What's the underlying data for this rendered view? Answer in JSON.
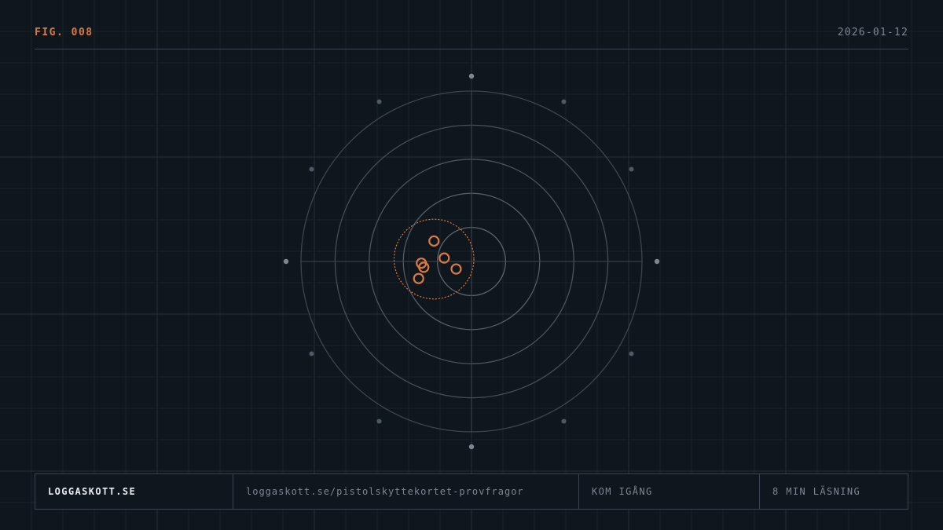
{
  "header": {
    "figure_label": "FIG. 008",
    "date": "2026-01-12"
  },
  "footer": {
    "site": "LOGGASKOTT.SE",
    "url": "loggaskott.se/pistolskyttekortet-provfragor",
    "cta": "KOM IGÅNG",
    "reading_time": "8 MIN LÄSNING"
  },
  "colors": {
    "background": "#0f161e",
    "accent": "#d97a42",
    "ring": "#5b646d",
    "marker": "#7d8791"
  },
  "target": {
    "ring_count": 5,
    "marker_count": 12,
    "shots": [
      {
        "x": -1.1,
        "y": 0.6
      },
      {
        "x": -0.8,
        "y": 0.1
      },
      {
        "x": -1.47,
        "y": -0.05
      },
      {
        "x": -1.4,
        "y": -0.17
      },
      {
        "x": -0.45,
        "y": -0.22
      },
      {
        "x": -1.55,
        "y": -0.5
      }
    ],
    "group": {
      "x": -1.1,
      "y": 0.07,
      "r": 1.17
    }
  }
}
